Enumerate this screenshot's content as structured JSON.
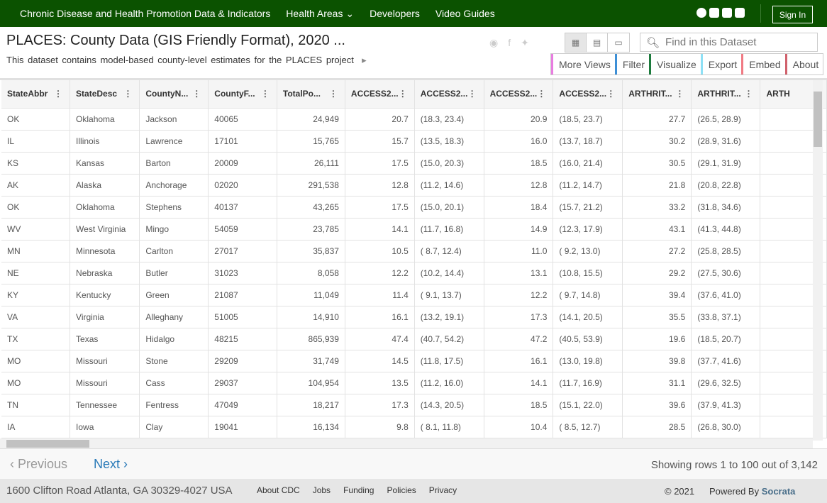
{
  "nav": {
    "links": [
      "Chronic Disease and Health Promotion Data & Indicators",
      "Health Areas ⌄",
      "Developers",
      "Video Guides"
    ],
    "social_icons": [
      "facebook-icon",
      "twitter-icon",
      "youtube-icon",
      "instagram-icon"
    ],
    "sign_in": "Sign In"
  },
  "dataset": {
    "title": "PLACES: County Data (GIS Friendly Format), 2020 ...",
    "description": "This dataset contains model-based county-level estimates for the PLACES project",
    "expand": "▸"
  },
  "search": {
    "placeholder": "Find in this Dataset"
  },
  "actions": [
    {
      "label": "More Views",
      "color": "#e87de0"
    },
    {
      "label": "Filter",
      "color": "#3d8fd6"
    },
    {
      "label": "Visualize",
      "color": "#1c7a3c"
    },
    {
      "label": "Export",
      "color": "#8ee0f5"
    },
    {
      "label": "Embed",
      "color": "#f07a83"
    },
    {
      "label": "About",
      "color": "#d0616c"
    }
  ],
  "table": {
    "columns": [
      "StateAbbr",
      "StateDesc",
      "CountyN...",
      "CountyF...",
      "TotalPo...",
      "ACCESS2...",
      "ACCESS2...",
      "ACCESS2...",
      "ACCESS2...",
      "ARTHRIT...",
      "ARTHRIT...",
      "ARTH"
    ],
    "rows": [
      [
        "OK",
        "Oklahoma",
        "Jackson",
        "40065",
        "24,949",
        "20.7",
        "(18.3, 23.4)",
        "20.9",
        "(18.5, 23.7)",
        "27.7",
        "(26.5, 28.9)"
      ],
      [
        "IL",
        "Illinois",
        "Lawrence",
        "17101",
        "15,765",
        "15.7",
        "(13.5, 18.3)",
        "16.0",
        "(13.7, 18.7)",
        "30.2",
        "(28.9, 31.6)"
      ],
      [
        "KS",
        "Kansas",
        "Barton",
        "20009",
        "26,111",
        "17.5",
        "(15.0, 20.3)",
        "18.5",
        "(16.0, 21.4)",
        "30.5",
        "(29.1, 31.9)"
      ],
      [
        "AK",
        "Alaska",
        "Anchorage",
        "02020",
        "291,538",
        "12.8",
        "(11.2, 14.6)",
        "12.8",
        "(11.2, 14.7)",
        "21.8",
        "(20.8, 22.8)"
      ],
      [
        "OK",
        "Oklahoma",
        "Stephens",
        "40137",
        "43,265",
        "17.5",
        "(15.0, 20.1)",
        "18.4",
        "(15.7, 21.2)",
        "33.2",
        "(31.8, 34.6)"
      ],
      [
        "WV",
        "West Virginia",
        "Mingo",
        "54059",
        "23,785",
        "14.1",
        "(11.7, 16.8)",
        "14.9",
        "(12.3, 17.9)",
        "43.1",
        "(41.3, 44.8)"
      ],
      [
        "MN",
        "Minnesota",
        "Carlton",
        "27017",
        "35,837",
        "10.5",
        "( 8.7, 12.4)",
        "11.0",
        "( 9.2, 13.0)",
        "27.2",
        "(25.8, 28.5)"
      ],
      [
        "NE",
        "Nebraska",
        "Butler",
        "31023",
        "8,058",
        "12.2",
        "(10.2, 14.4)",
        "13.1",
        "(10.8, 15.5)",
        "29.2",
        "(27.5, 30.6)"
      ],
      [
        "KY",
        "Kentucky",
        "Green",
        "21087",
        "11,049",
        "11.4",
        "( 9.1, 13.7)",
        "12.2",
        "( 9.7, 14.8)",
        "39.4",
        "(37.6, 41.0)"
      ],
      [
        "VA",
        "Virginia",
        "Alleghany",
        "51005",
        "14,910",
        "16.1",
        "(13.2, 19.1)",
        "17.3",
        "(14.1, 20.5)",
        "35.5",
        "(33.8, 37.1)"
      ],
      [
        "TX",
        "Texas",
        "Hidalgo",
        "48215",
        "865,939",
        "47.4",
        "(40.7, 54.2)",
        "47.2",
        "(40.5, 53.9)",
        "19.6",
        "(18.5, 20.7)"
      ],
      [
        "MO",
        "Missouri",
        "Stone",
        "29209",
        "31,749",
        "14.5",
        "(11.8, 17.5)",
        "16.1",
        "(13.0, 19.8)",
        "39.8",
        "(37.7, 41.6)"
      ],
      [
        "MO",
        "Missouri",
        "Cass",
        "29037",
        "104,954",
        "13.5",
        "(11.2, 16.0)",
        "14.1",
        "(11.7, 16.9)",
        "31.1",
        "(29.6, 32.5)"
      ],
      [
        "TN",
        "Tennessee",
        "Fentress",
        "47049",
        "18,217",
        "17.3",
        "(14.3, 20.5)",
        "18.5",
        "(15.1, 22.0)",
        "39.6",
        "(37.9, 41.3)"
      ],
      [
        "IA",
        "Iowa",
        "Clay",
        "19041",
        "16,134",
        "9.8",
        "( 8.1, 11.8)",
        "10.4",
        "( 8.5, 12.7)",
        "28.5",
        "(26.8, 30.0)"
      ]
    ]
  },
  "pager": {
    "previous": "Previous",
    "next": "Next",
    "showing": "Showing rows 1 to 100 out of 3,142"
  },
  "footer": {
    "address": "1600 Clifton Road Atlanta, GA 30329-4027 USA",
    "links": [
      "About CDC",
      "Jobs",
      "Funding",
      "Policies",
      "Privacy"
    ],
    "copyright": "© 2021",
    "powered_by": "Powered By",
    "brand": "Socrata"
  }
}
